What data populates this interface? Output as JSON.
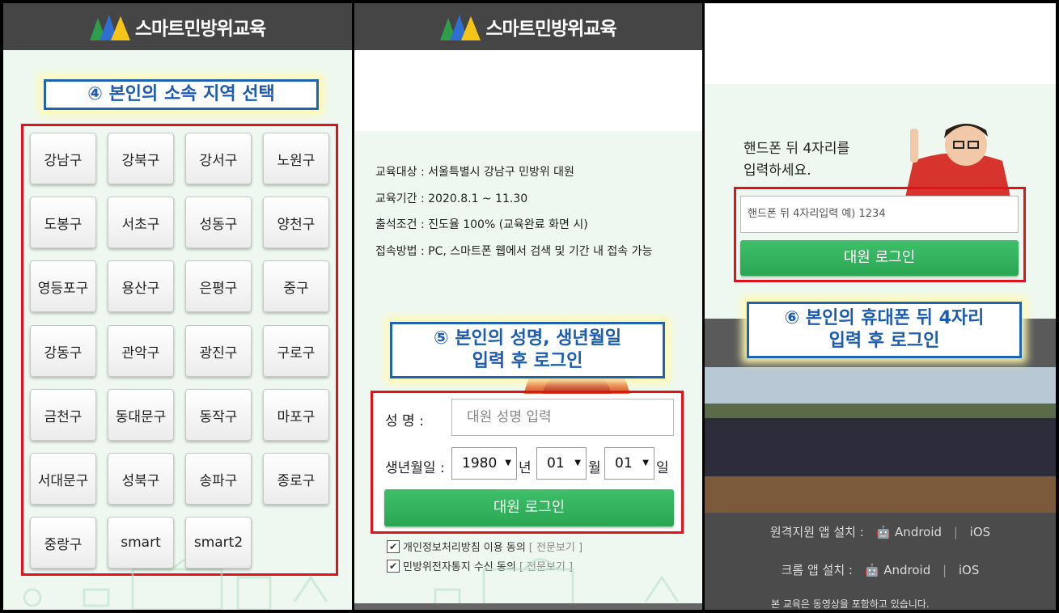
{
  "app_name": "스마트민방위교육",
  "panel1": {
    "callout": "④ 본인의 소속 지역 선택",
    "districts": [
      "강남구",
      "강북구",
      "강서구",
      "노원구",
      "도봉구",
      "서초구",
      "성동구",
      "양천구",
      "영등포구",
      "용산구",
      "은평구",
      "중구",
      "강동구",
      "관악구",
      "광진구",
      "구로구",
      "금천구",
      "동대문구",
      "동작구",
      "마포구",
      "서대문구",
      "성북구",
      "송파구",
      "종로구",
      "중랑구",
      "smart",
      "smart2"
    ]
  },
  "panel2": {
    "info": [
      "교육대상 : 서울특별시 강남구 민방위 대원",
      "교육기간 : 2020.8.1 ~ 11.30",
      "출석조건 : 진도율 100% (교육완료 화면 시)",
      "접속방법 : PC, 스마트폰 웹에서 검색 및 기간 내 접속 가능"
    ],
    "callout_line1": "⑤ 본인의 성명, 생년월일",
    "callout_line2": "입력 후 로그인",
    "name_label": "성    명 :",
    "name_placeholder": "대원 성명 입력",
    "birth_label": "생년월일 :",
    "year": "1980",
    "year_unit": "년",
    "month": "01",
    "month_unit": "월",
    "day": "01",
    "day_unit": "일",
    "login": "대원 로그인",
    "agree1": "개인정보처리방침 이용 동의",
    "agree2": "민방위전자통지 수신 동의",
    "view_full": "[ 전문보기 ]"
  },
  "panel3": {
    "prompt_line1": "핸드폰 뒤 4자리를",
    "prompt_line2": "입력하세요.",
    "phone_placeholder": "핸드폰 뒤 4자리입력 예) 1234",
    "login": "대원 로그인",
    "callout_line1": "⑥ 본인의 휴대폰 뒤 4자리",
    "callout_line2": "입력 후 로그인",
    "remote_label": "원격지원 앱 설치 :",
    "chrome_label": "크롬 앱 설치 :",
    "android": "Android",
    "ios": "iOS",
    "note": "본 교육은 동영상을 포함하고 있습니다."
  }
}
